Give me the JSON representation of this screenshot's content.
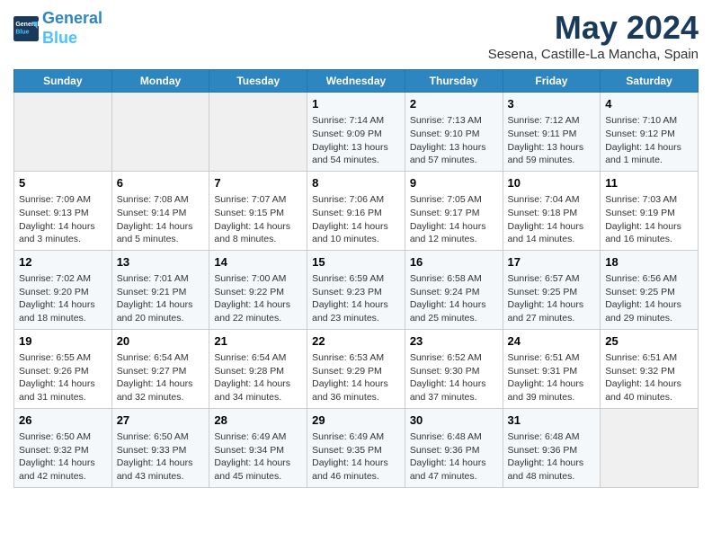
{
  "header": {
    "logo_line1": "General",
    "logo_line2": "Blue",
    "title": "May 2024",
    "location": "Sesena, Castille-La Mancha, Spain"
  },
  "days_of_week": [
    "Sunday",
    "Monday",
    "Tuesday",
    "Wednesday",
    "Thursday",
    "Friday",
    "Saturday"
  ],
  "weeks": [
    [
      {
        "day": "",
        "info": ""
      },
      {
        "day": "",
        "info": ""
      },
      {
        "day": "",
        "info": ""
      },
      {
        "day": "1",
        "info": "Sunrise: 7:14 AM\nSunset: 9:09 PM\nDaylight: 13 hours and 54 minutes."
      },
      {
        "day": "2",
        "info": "Sunrise: 7:13 AM\nSunset: 9:10 PM\nDaylight: 13 hours and 57 minutes."
      },
      {
        "day": "3",
        "info": "Sunrise: 7:12 AM\nSunset: 9:11 PM\nDaylight: 13 hours and 59 minutes."
      },
      {
        "day": "4",
        "info": "Sunrise: 7:10 AM\nSunset: 9:12 PM\nDaylight: 14 hours and 1 minute."
      }
    ],
    [
      {
        "day": "5",
        "info": "Sunrise: 7:09 AM\nSunset: 9:13 PM\nDaylight: 14 hours and 3 minutes."
      },
      {
        "day": "6",
        "info": "Sunrise: 7:08 AM\nSunset: 9:14 PM\nDaylight: 14 hours and 5 minutes."
      },
      {
        "day": "7",
        "info": "Sunrise: 7:07 AM\nSunset: 9:15 PM\nDaylight: 14 hours and 8 minutes."
      },
      {
        "day": "8",
        "info": "Sunrise: 7:06 AM\nSunset: 9:16 PM\nDaylight: 14 hours and 10 minutes."
      },
      {
        "day": "9",
        "info": "Sunrise: 7:05 AM\nSunset: 9:17 PM\nDaylight: 14 hours and 12 minutes."
      },
      {
        "day": "10",
        "info": "Sunrise: 7:04 AM\nSunset: 9:18 PM\nDaylight: 14 hours and 14 minutes."
      },
      {
        "day": "11",
        "info": "Sunrise: 7:03 AM\nSunset: 9:19 PM\nDaylight: 14 hours and 16 minutes."
      }
    ],
    [
      {
        "day": "12",
        "info": "Sunrise: 7:02 AM\nSunset: 9:20 PM\nDaylight: 14 hours and 18 minutes."
      },
      {
        "day": "13",
        "info": "Sunrise: 7:01 AM\nSunset: 9:21 PM\nDaylight: 14 hours and 20 minutes."
      },
      {
        "day": "14",
        "info": "Sunrise: 7:00 AM\nSunset: 9:22 PM\nDaylight: 14 hours and 22 minutes."
      },
      {
        "day": "15",
        "info": "Sunrise: 6:59 AM\nSunset: 9:23 PM\nDaylight: 14 hours and 23 minutes."
      },
      {
        "day": "16",
        "info": "Sunrise: 6:58 AM\nSunset: 9:24 PM\nDaylight: 14 hours and 25 minutes."
      },
      {
        "day": "17",
        "info": "Sunrise: 6:57 AM\nSunset: 9:25 PM\nDaylight: 14 hours and 27 minutes."
      },
      {
        "day": "18",
        "info": "Sunrise: 6:56 AM\nSunset: 9:25 PM\nDaylight: 14 hours and 29 minutes."
      }
    ],
    [
      {
        "day": "19",
        "info": "Sunrise: 6:55 AM\nSunset: 9:26 PM\nDaylight: 14 hours and 31 minutes."
      },
      {
        "day": "20",
        "info": "Sunrise: 6:54 AM\nSunset: 9:27 PM\nDaylight: 14 hours and 32 minutes."
      },
      {
        "day": "21",
        "info": "Sunrise: 6:54 AM\nSunset: 9:28 PM\nDaylight: 14 hours and 34 minutes."
      },
      {
        "day": "22",
        "info": "Sunrise: 6:53 AM\nSunset: 9:29 PM\nDaylight: 14 hours and 36 minutes."
      },
      {
        "day": "23",
        "info": "Sunrise: 6:52 AM\nSunset: 9:30 PM\nDaylight: 14 hours and 37 minutes."
      },
      {
        "day": "24",
        "info": "Sunrise: 6:51 AM\nSunset: 9:31 PM\nDaylight: 14 hours and 39 minutes."
      },
      {
        "day": "25",
        "info": "Sunrise: 6:51 AM\nSunset: 9:32 PM\nDaylight: 14 hours and 40 minutes."
      }
    ],
    [
      {
        "day": "26",
        "info": "Sunrise: 6:50 AM\nSunset: 9:32 PM\nDaylight: 14 hours and 42 minutes."
      },
      {
        "day": "27",
        "info": "Sunrise: 6:50 AM\nSunset: 9:33 PM\nDaylight: 14 hours and 43 minutes."
      },
      {
        "day": "28",
        "info": "Sunrise: 6:49 AM\nSunset: 9:34 PM\nDaylight: 14 hours and 45 minutes."
      },
      {
        "day": "29",
        "info": "Sunrise: 6:49 AM\nSunset: 9:35 PM\nDaylight: 14 hours and 46 minutes."
      },
      {
        "day": "30",
        "info": "Sunrise: 6:48 AM\nSunset: 9:36 PM\nDaylight: 14 hours and 47 minutes."
      },
      {
        "day": "31",
        "info": "Sunrise: 6:48 AM\nSunset: 9:36 PM\nDaylight: 14 hours and 48 minutes."
      },
      {
        "day": "",
        "info": ""
      }
    ]
  ]
}
